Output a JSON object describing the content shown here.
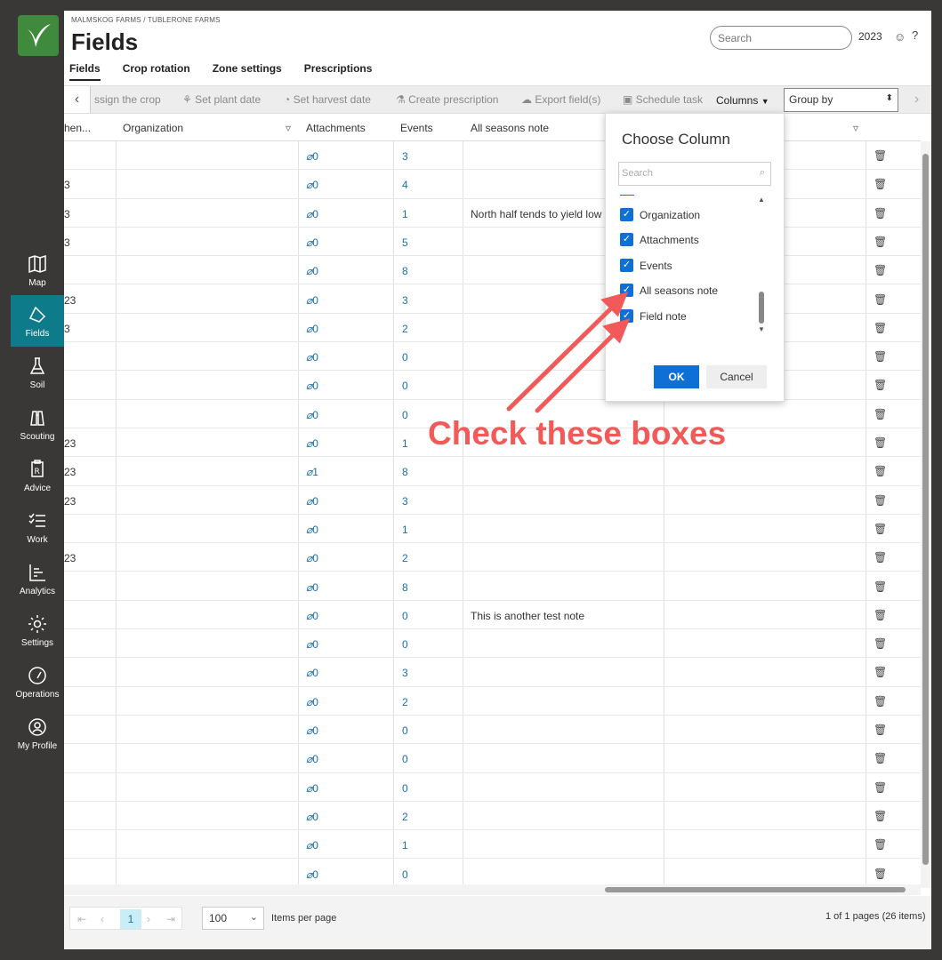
{
  "nav": {
    "items": [
      {
        "label": "Map",
        "icon": "map-icon"
      },
      {
        "label": "Fields",
        "icon": "fields-icon"
      },
      {
        "label": "Soil",
        "icon": "flask-icon"
      },
      {
        "label": "Scouting",
        "icon": "binoculars-icon"
      },
      {
        "label": "Advice",
        "icon": "prescription-icon"
      },
      {
        "label": "Work",
        "icon": "checklist-icon"
      },
      {
        "label": "Analytics",
        "icon": "analytics-icon"
      },
      {
        "label": "Settings",
        "icon": "gear-icon"
      },
      {
        "label": "Operations",
        "icon": "gauge-icon"
      },
      {
        "label": "My Profile",
        "icon": "user-icon"
      }
    ]
  },
  "header": {
    "breadcrumb": "MALMSKOG FARMS / TUBLERONE FARMS",
    "title": "Fields",
    "search_placeholder": "Search",
    "year": "2023"
  },
  "tabs": [
    "Fields",
    "Crop rotation",
    "Zone settings",
    "Prescriptions"
  ],
  "toolbar": {
    "assign_crop": "ssign the crop",
    "set_plant_date": "Set plant date",
    "set_harvest_date": "Set harvest date",
    "create_prescription": "Create prescription",
    "export_fields": "Export field(s)",
    "schedule_task": "Schedule task",
    "columns": "Columns",
    "group_by": "Group by"
  },
  "columns": {
    "first": "hen...",
    "organization": "Organization",
    "attachments": "Attachments",
    "events": "Events",
    "all_seasons_note": "All seasons note"
  },
  "rows": [
    {
      "first": "",
      "attach": "0",
      "events": "3",
      "note": ""
    },
    {
      "first": "3",
      "attach": "0",
      "events": "4",
      "note": ""
    },
    {
      "first": "3",
      "attach": "0",
      "events": "1",
      "note": "North half tends to yield low"
    },
    {
      "first": "3",
      "attach": "0",
      "events": "5",
      "note": ""
    },
    {
      "first": "",
      "attach": "0",
      "events": "8",
      "note": ""
    },
    {
      "first": "23",
      "attach": "0",
      "events": "3",
      "note": ""
    },
    {
      "first": "3",
      "attach": "0",
      "events": "2",
      "note": ""
    },
    {
      "first": "",
      "attach": "0",
      "events": "0",
      "note": ""
    },
    {
      "first": "",
      "attach": "0",
      "events": "0",
      "note": ""
    },
    {
      "first": "",
      "attach": "0",
      "events": "0",
      "note": ""
    },
    {
      "first": "23",
      "attach": "0",
      "events": "1",
      "note": ""
    },
    {
      "first": "23",
      "attach": "1",
      "events": "8",
      "note": ""
    },
    {
      "first": "23",
      "attach": "0",
      "events": "3",
      "note": ""
    },
    {
      "first": "",
      "attach": "0",
      "events": "1",
      "note": ""
    },
    {
      "first": "23",
      "attach": "0",
      "events": "2",
      "note": ""
    },
    {
      "first": "",
      "attach": "0",
      "events": "8",
      "note": ""
    },
    {
      "first": "",
      "attach": "0",
      "events": "0",
      "note": "This is another test note"
    },
    {
      "first": "",
      "attach": "0",
      "events": "0",
      "note": ""
    },
    {
      "first": "",
      "attach": "0",
      "events": "3",
      "note": ""
    },
    {
      "first": "",
      "attach": "0",
      "events": "2",
      "note": ""
    },
    {
      "first": "",
      "attach": "0",
      "events": "0",
      "note": ""
    },
    {
      "first": "",
      "attach": "0",
      "events": "0",
      "note": ""
    },
    {
      "first": "",
      "attach": "0",
      "events": "0",
      "note": ""
    },
    {
      "first": "",
      "attach": "0",
      "events": "2",
      "note": ""
    },
    {
      "first": "",
      "attach": "0",
      "events": "1",
      "note": ""
    },
    {
      "first": "",
      "attach": "0",
      "events": "0",
      "note": ""
    }
  ],
  "chooser": {
    "title": "Choose Column",
    "search_placeholder": "Search",
    "items": [
      "Organization",
      "Attachments",
      "Events",
      "All seasons note",
      "Field note"
    ],
    "ok": "OK",
    "cancel": "Cancel"
  },
  "pager": {
    "current_page": "1",
    "per_page": "100",
    "per_page_label": "Items per page",
    "info": "1 of 1 pages (26 items)"
  },
  "annotation": {
    "text": "Check these boxes",
    "color": "#f25a5a"
  },
  "colors": {
    "accent": "#0e6fd6",
    "active_nav": "#0e7b8a",
    "link": "#1d6fa5",
    "logo": "#3f8a3c"
  }
}
